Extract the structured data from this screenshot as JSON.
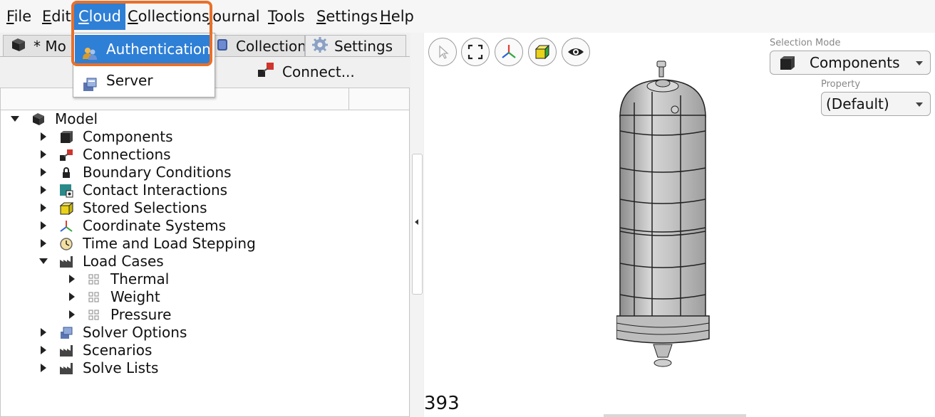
{
  "menubar": {
    "items": [
      {
        "label": "File",
        "u": "F",
        "rest": "ile"
      },
      {
        "label": "Edit",
        "u": "E",
        "rest": "dit"
      },
      {
        "label": "Cloud",
        "u": "C",
        "rest": "loud"
      },
      {
        "label": "Collections",
        "u": "C",
        "rest": "ollections"
      },
      {
        "label": "Journal",
        "u": "J",
        "rest": "ournal"
      },
      {
        "label": "Tools",
        "u": "T",
        "rest": "ools"
      },
      {
        "label": "Settings",
        "u": "S",
        "rest": "ettings"
      },
      {
        "label": "Help",
        "u": "H",
        "rest": "elp"
      }
    ]
  },
  "cloud_menu": {
    "items": [
      {
        "label": "Authentication",
        "icon": "users-icon"
      },
      {
        "label": "Server",
        "icon": "server-icon"
      }
    ]
  },
  "tabs": [
    {
      "label": "* Mo",
      "icon": "model-cube-icon"
    },
    {
      "label": "Collection",
      "icon": "collection-icon"
    },
    {
      "label": "Settings",
      "icon": "gear-icon"
    }
  ],
  "toolbar": {
    "connect_label": "Connect..."
  },
  "tree": {
    "root": "Model",
    "items": [
      {
        "label": "Components",
        "icon": "component-cube-icon"
      },
      {
        "label": "Connections",
        "icon": "connection-icon"
      },
      {
        "label": "Boundary Conditions",
        "icon": "lock-icon"
      },
      {
        "label": "Contact Interactions",
        "icon": "contact-icon"
      },
      {
        "label": "Stored Selections",
        "icon": "stored-selection-icon"
      },
      {
        "label": "Coordinate Systems",
        "icon": "axes-icon"
      },
      {
        "label": "Time and Load Stepping",
        "icon": "clock-icon"
      },
      {
        "label": "Load Cases",
        "icon": "factory-icon"
      },
      {
        "label": "Thermal",
        "icon": "grid-icon"
      },
      {
        "label": "Weight",
        "icon": "grid-icon"
      },
      {
        "label": "Pressure",
        "icon": "grid-icon"
      },
      {
        "label": "Solver Options",
        "icon": "solver-icon"
      },
      {
        "label": "Scenarios",
        "icon": "factory-icon"
      },
      {
        "label": "Solve Lists",
        "icon": "factory-icon"
      }
    ]
  },
  "viewport": {
    "selection_mode_label": "Selection Mode",
    "selection_mode_value": "Components",
    "property_label": "Property",
    "property_value": "(Default)",
    "counter": "393"
  },
  "colors": {
    "accent": "#2e7fd6",
    "highlight_box": "#e8702a"
  }
}
